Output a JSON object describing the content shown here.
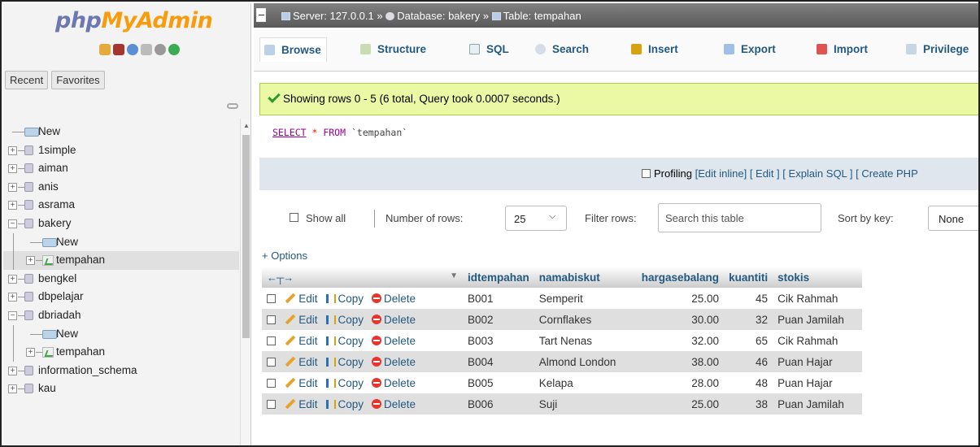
{
  "sidebar": {
    "logo_part1": "php",
    "logo_part2": "MyAdmin",
    "icons": [
      "home-icon",
      "logout-icon",
      "docs-icon",
      "sql-docs-icon",
      "settings-icon",
      "reload-icon"
    ],
    "recent_label": "Recent",
    "favorites_label": "Favorites",
    "tree": [
      {
        "label": "New",
        "level": 0,
        "kind": "new"
      },
      {
        "label": "1simple",
        "level": 0,
        "kind": "db"
      },
      {
        "label": "aiman",
        "level": 0,
        "kind": "db"
      },
      {
        "label": "anis",
        "level": 0,
        "kind": "db"
      },
      {
        "label": "asrama",
        "level": 0,
        "kind": "db"
      },
      {
        "label": "bakery",
        "level": 0,
        "kind": "db-open"
      },
      {
        "label": "New",
        "level": 1,
        "kind": "new"
      },
      {
        "label": "tempahan",
        "level": 1,
        "kind": "table",
        "selected": true
      },
      {
        "label": "bengkel",
        "level": 0,
        "kind": "db"
      },
      {
        "label": "dbpelajar",
        "level": 0,
        "kind": "db"
      },
      {
        "label": "dbriadah",
        "level": 0,
        "kind": "db-open"
      },
      {
        "label": "New",
        "level": 1,
        "kind": "new"
      },
      {
        "label": "tempahan",
        "level": 1,
        "kind": "table"
      },
      {
        "label": "information_schema",
        "level": 0,
        "kind": "db"
      },
      {
        "label": "kau",
        "level": 0,
        "kind": "db"
      }
    ]
  },
  "breadcrumb": {
    "server": "Server: 127.0.0.1",
    "database": "Database: bakery",
    "table": "Table: tempahan",
    "sep": " » "
  },
  "tabs": [
    "Browse",
    "Structure",
    "SQL",
    "Search",
    "Insert",
    "Export",
    "Import",
    "Privilege"
  ],
  "message": "Showing rows 0 - 5 (6 total, Query took 0.0007 seconds.)",
  "sql": {
    "select": "SELECT",
    "star": " * ",
    "from": "FROM",
    "table": "`tempahan`"
  },
  "profiling": {
    "label": "Profiling",
    "links": [
      "[Edit inline]",
      "[ Edit ]",
      "[ Explain SQL ]",
      "[ Create PHP"
    ]
  },
  "controls": {
    "show_all": "Show all",
    "number_of_rows_label": "Number of rows:",
    "number_of_rows_value": "25",
    "filter_label": "Filter rows:",
    "filter_placeholder": "Search this table",
    "sort_label": "Sort by key:",
    "sort_value": "None"
  },
  "options_label": "+ Options",
  "table": {
    "columns": [
      "idtempahan",
      "namabiskut",
      "hargasebalang",
      "kuantiti",
      "stokis"
    ],
    "actions": {
      "edit": "Edit",
      "copy": "Copy",
      "delete": "Delete"
    },
    "rows": [
      [
        "B001",
        "Semperit",
        "25.00",
        "45",
        "Cik Rahmah"
      ],
      [
        "B002",
        "Cornflakes",
        "30.00",
        "32",
        "Puan Jamilah"
      ],
      [
        "B003",
        "Tart Nenas",
        "32.00",
        "65",
        "Cik Rahmah"
      ],
      [
        "B004",
        "Almond London",
        "38.00",
        "46",
        "Puan Hajar"
      ],
      [
        "B005",
        "Kelapa",
        "28.00",
        "48",
        "Puan Hajar"
      ],
      [
        "B006",
        "Suji",
        "25.00",
        "38",
        "Puan Jamilah"
      ]
    ]
  },
  "colors": {
    "accent": "#235a81",
    "success_bg": "#ebf8a4",
    "crumb_bg": "#6d6d6d"
  }
}
